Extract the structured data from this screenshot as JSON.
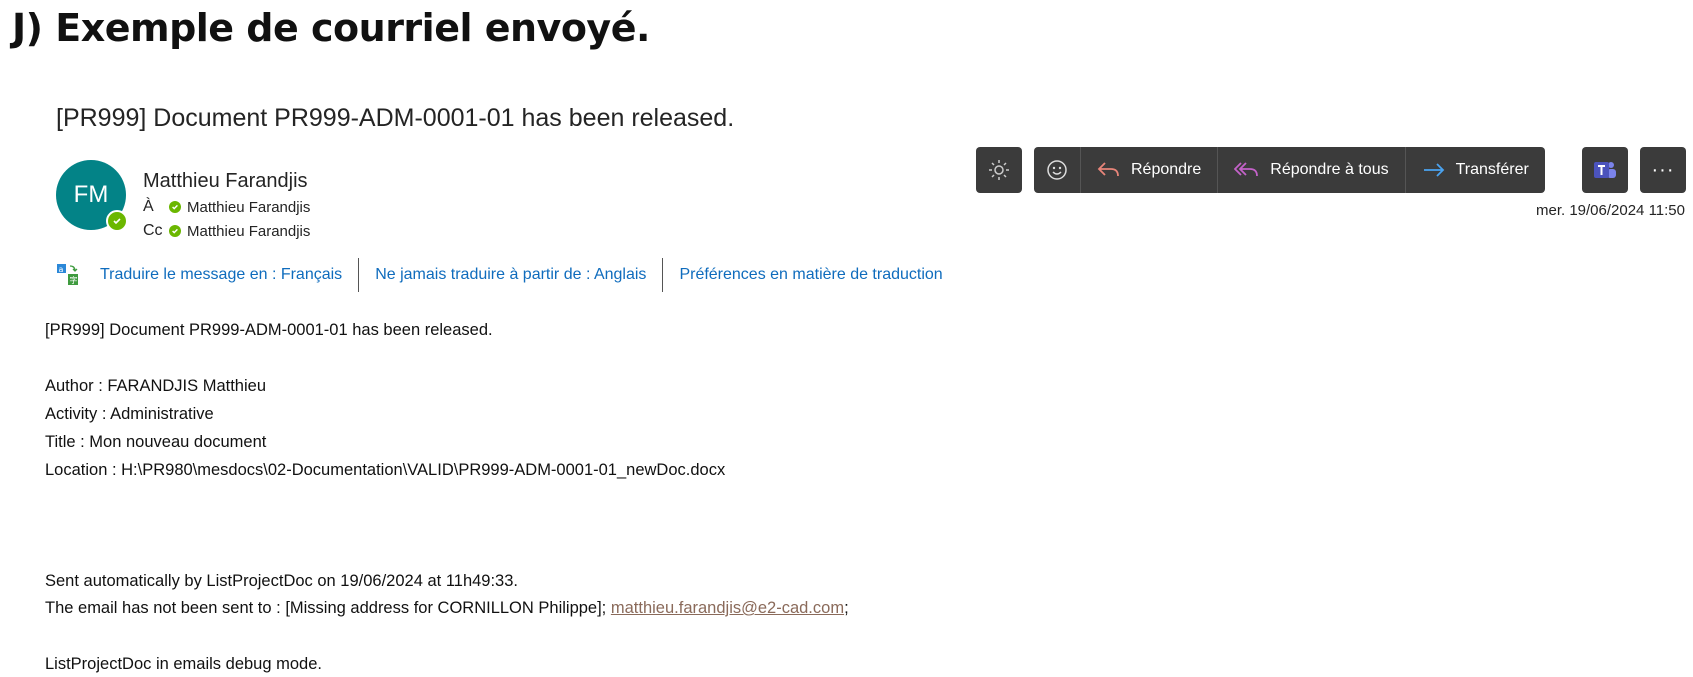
{
  "heading": "J) Exemple de courriel envoyé.",
  "email": {
    "subject": "[PR999] Document PR999-ADM-0001-01 has been released.",
    "avatar_initials": "FM",
    "sender": "Matthieu Farandjis",
    "to_label": "À",
    "to": "Matthieu Farandjis",
    "cc_label": "Cc",
    "cc": "Matthieu Farandjis",
    "date": "mer. 19/06/2024 11:50"
  },
  "toolbar": {
    "reply": "Répondre",
    "reply_all": "Répondre à tous",
    "forward": "Transférer",
    "teams_icon": "teams-icon",
    "more": "···"
  },
  "translation": {
    "translate_to": "Traduire le message en : Français",
    "never_translate": "Ne jamais traduire à partir de : Anglais",
    "preferences": "Préférences en matière de traduction"
  },
  "body": {
    "line1": "[PR999] Document PR999-ADM-0001-01 has been released.",
    "author": "Author : FARANDJIS Matthieu",
    "activity": "Activity : Administrative",
    "title": "Title : Mon nouveau document",
    "location": "Location : H:\\PR980\\mesdocs\\02-Documentation\\VALID\\PR999-ADM-0001-01_newDoc.docx",
    "sent_auto": "Sent automatically by ListProjectDoc on 19/06/2024 at 11h49:33.",
    "not_sent_prefix": "The email has not been sent to : [Missing address for CORNILLON Philippe];",
    "not_sent_link": "matthieu.farandjis@e2-cad.com",
    "not_sent_suffix": ";",
    "debug": "ListProjectDoc in emails debug mode."
  },
  "colors": {
    "avatar": "#038387",
    "presence": "#6bb700",
    "toolbar_bg": "#3b3b3b",
    "link": "#0f6cbd",
    "reply_arrow": "#e8857a",
    "reply_all_arrow": "#c462c9",
    "forward_arrow": "#4aa3f0"
  }
}
